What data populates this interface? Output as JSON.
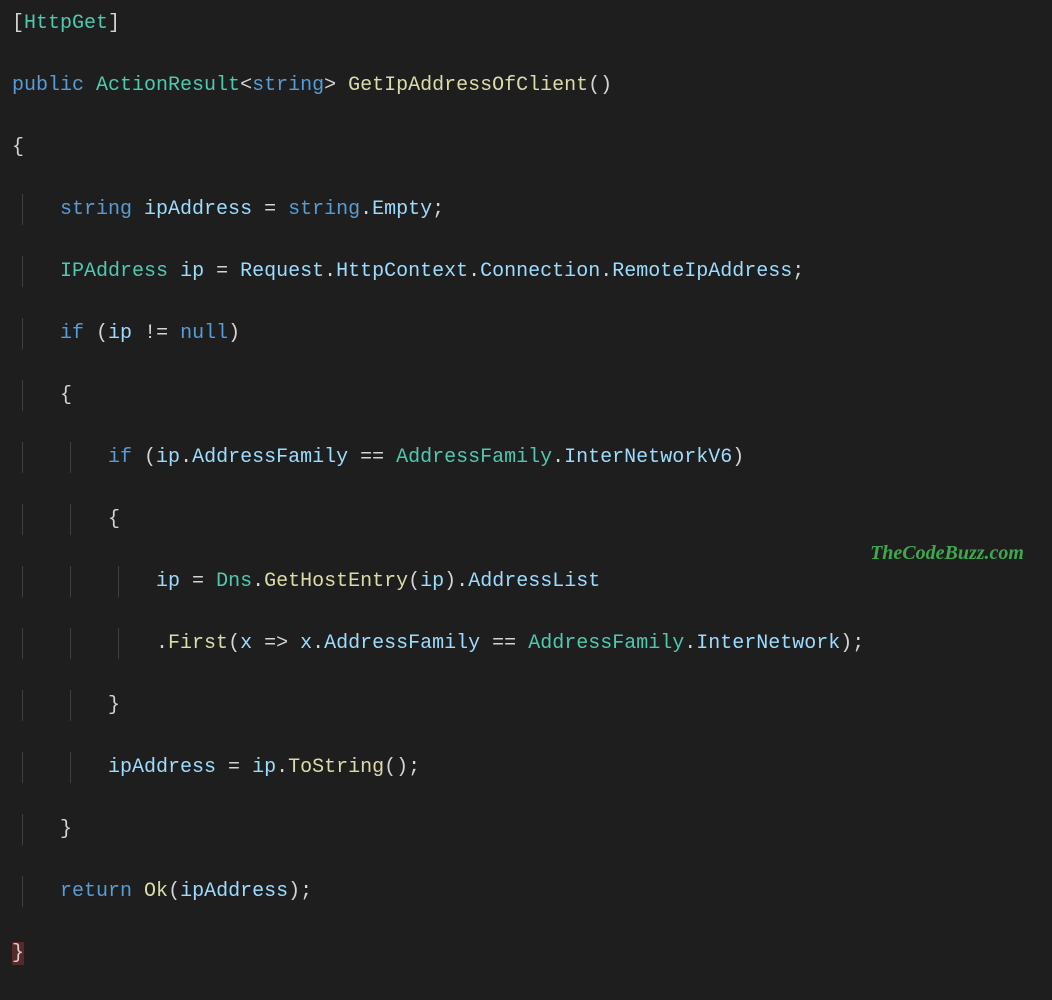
{
  "code": {
    "l1_open_br": "[",
    "l1_attr": "HttpGet",
    "l1_close_br": "]",
    "l2_public": "public",
    "l2_type": "ActionResult",
    "l2_lt": "<",
    "l2_generic": "string",
    "l2_gt": ">",
    "l2_method": "GetIpAddressOfClient",
    "l2_paren": "()",
    "l3_brace": "{",
    "l4_kw": "string",
    "l4_var": "ipAddress",
    "l4_eq": " = ",
    "l4_string_kw": "string",
    "l4_dot": ".",
    "l4_empty": "Empty",
    "l4_semi": ";",
    "l5_type": "IPAddress",
    "l5_var": "ip",
    "l5_eq": " = ",
    "l5_request": "Request",
    "l5_d1": ".",
    "l5_httpctx": "HttpContext",
    "l5_d2": ".",
    "l5_conn": "Connection",
    "l5_d3": ".",
    "l5_remote": "RemoteIpAddress",
    "l5_semi": ";",
    "l6_if": "if",
    "l6_open": " (",
    "l6_ip": "ip",
    "l6_neq": " != ",
    "l6_null": "null",
    "l6_close": ")",
    "l7_brace": "{",
    "l8_if": "if",
    "l8_open": " (",
    "l8_ip": "ip",
    "l8_dot": ".",
    "l8_af": "AddressFamily",
    "l8_eqeq": " == ",
    "l8_afenum": "AddressFamily",
    "l8_dot2": ".",
    "l8_v6": "InterNetworkV6",
    "l8_close": ")",
    "l9_brace": "{",
    "l10_ip": "ip",
    "l10_eq": " = ",
    "l10_dns": "Dns",
    "l10_dot": ".",
    "l10_ghe": "GetHostEntry",
    "l10_open": "(",
    "l10_arg": "ip",
    "l10_close": ")",
    "l10_dot2": ".",
    "l10_al": "AddressList",
    "l11_dot": ".",
    "l11_first": "First",
    "l11_open": "(",
    "l11_x": "x",
    "l11_arrow": " => ",
    "l11_x2": "x",
    "l11_dot2": ".",
    "l11_af": "AddressFamily",
    "l11_eqeq": " == ",
    "l11_afenum": "AddressFamily",
    "l11_dot3": ".",
    "l11_inet": "InterNetwork",
    "l11_close": ");",
    "l12_brace": "}",
    "l13_var": "ipAddress",
    "l13_eq": " = ",
    "l13_ip": "ip",
    "l13_dot": ".",
    "l13_ts": "ToString",
    "l13_paren": "();",
    "l14_brace": "}",
    "l15_return": "return",
    "l15_sp": " ",
    "l15_ok": "Ok",
    "l15_open": "(",
    "l15_arg": "ipAddress",
    "l15_close": ");",
    "l16_brace": "}"
  },
  "watermark": "TheCodeBuzz.com"
}
